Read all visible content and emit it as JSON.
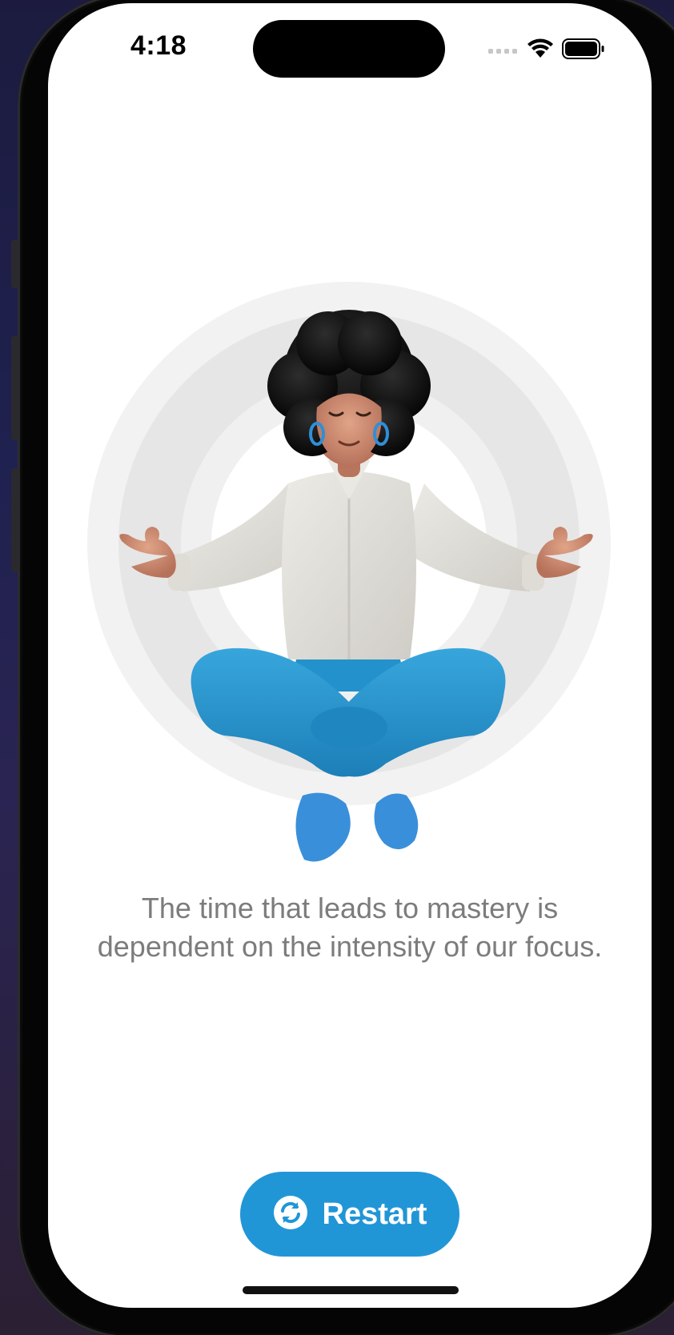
{
  "status_bar": {
    "time": "4:18",
    "signal_icon": "cellular-signal-icon",
    "wifi_icon": "wifi-icon",
    "battery_icon": "battery-icon"
  },
  "illustration": {
    "icon": "meditating-person-illustration"
  },
  "quote": {
    "line1": "The time that leads to mastery is",
    "line2": "dependent on the intensity of our focus."
  },
  "restart_button": {
    "label": "Restart",
    "icon": "refresh-icon",
    "color": "#2196d7"
  }
}
